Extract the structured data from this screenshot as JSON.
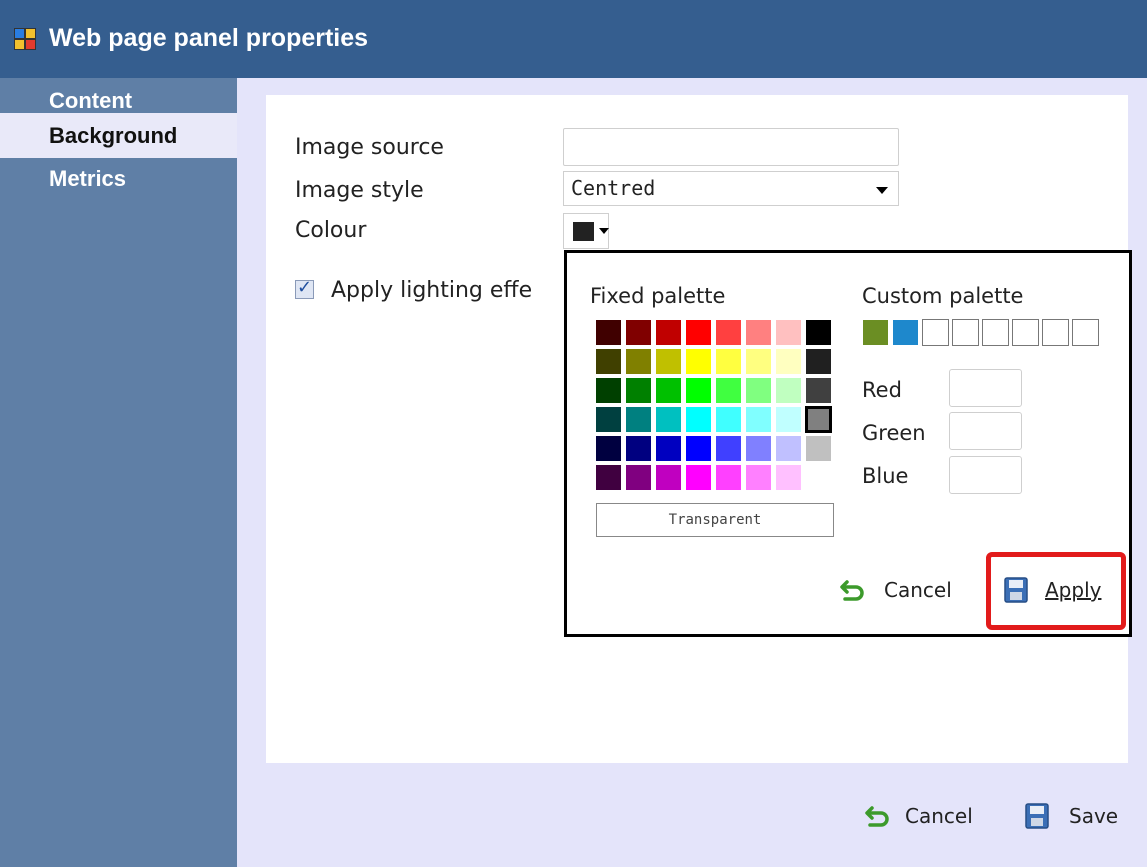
{
  "window": {
    "title": "Web page panel properties"
  },
  "sidebar": {
    "items": [
      {
        "label": "Content"
      },
      {
        "label": "Background"
      },
      {
        "label": "Metrics"
      }
    ]
  },
  "form": {
    "image_source_label": "Image source",
    "image_source_value": "",
    "image_style_label": "Image style",
    "image_style_value": "Centred",
    "colour_label": "Colour",
    "colour_value": "#222222",
    "lighting_label": "Apply lighting effe",
    "lighting_checked": true
  },
  "popup": {
    "fixed_palette_title": "Fixed palette",
    "custom_palette_title": "Custom palette",
    "fixed_palette": [
      [
        "#400000",
        "#800000",
        "#c00000",
        "#ff0000",
        "#ff4040",
        "#ff8080",
        "#ffc0c0",
        "#000000"
      ],
      [
        "#404000",
        "#808000",
        "#c0c000",
        "#ffff00",
        "#ffff40",
        "#ffff80",
        "#ffffc0",
        "#202020"
      ],
      [
        "#004000",
        "#008000",
        "#00c000",
        "#00ff00",
        "#40ff40",
        "#80ff80",
        "#c0ffc0",
        "#404040"
      ],
      [
        "#004040",
        "#008080",
        "#00c0c0",
        "#00ffff",
        "#40ffff",
        "#80ffff",
        "#c0ffff",
        "#808080"
      ],
      [
        "#000040",
        "#000080",
        "#0000c0",
        "#0000ff",
        "#4040ff",
        "#8080ff",
        "#c0c0ff",
        "#c0c0c0"
      ],
      [
        "#400040",
        "#800080",
        "#c000c0",
        "#ff00ff",
        "#ff40ff",
        "#ff80ff",
        "#ffc0ff",
        "#ffffff"
      ]
    ],
    "selected_cell": "#808080",
    "transparent_label": "Transparent",
    "custom_palette": [
      "#6b8e23",
      "#1e88cc",
      "#ffffff",
      "#ffffff",
      "#ffffff",
      "#ffffff",
      "#ffffff",
      "#ffffff"
    ],
    "red_label": "Red",
    "green_label": "Green",
    "blue_label": "Blue",
    "cancel_label": "Cancel",
    "apply_label": "Apply"
  },
  "footer": {
    "cancel_label": "Cancel",
    "save_label": "Save"
  }
}
